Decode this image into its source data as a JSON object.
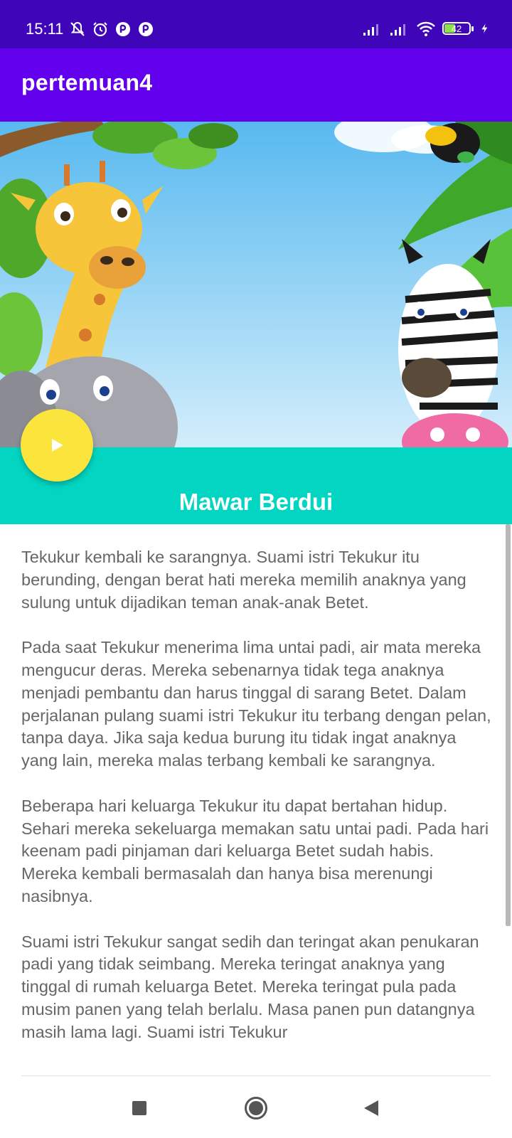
{
  "status_bar": {
    "time": "15:11",
    "icons_left": [
      "notifications-off-icon",
      "alarm-icon",
      "app-icon-1",
      "app-icon-2"
    ],
    "icons_right": [
      "signal-1-icon",
      "signal-2-icon",
      "wifi-icon",
      "battery-icon",
      "charging-icon"
    ],
    "battery_level": "42"
  },
  "app_bar": {
    "title": "pertemuan4"
  },
  "song": {
    "title": "Mawar Berdui"
  },
  "fab": {
    "icon": "play-icon"
  },
  "story": {
    "paragraphs": [
      "Tekukur kembali ke sarangnya. Suami istri Tekukur itu berunding, dengan berat hati mereka memilih anaknya yang sulung untuk dijadikan teman anak-anak Betet.",
      "Pada saat Tekukur menerima lima untai padi, air mata mereka mengucur deras. Mereka sebenarnya tidak tega anaknya menjadi pembantu dan harus tinggal di sarang Betet. Dalam perjalanan pulang suami istri Tekukur itu terbang dengan pelan, tanpa daya. Jika saja kedua burung itu tidak ingat anaknya yang lain, mereka malas terbang kembali ke sarangnya.",
      "Beberapa hari keluarga Tekukur itu dapat bertahan hidup. Sehari mereka sekeluarga memakan satu untai padi. Pada hari keenam padi pinjaman dari keluarga Betet sudah habis. Mereka kembali bermasalah dan hanya bisa merenungi nasibnya.",
      "Suami istri Tekukur sangat sedih dan teringat akan penukaran padi yang tidak seimbang. Mereka teringat anaknya yang tinggal di rumah keluarga Betet. Mereka teringat pula pada musim panen yang telah berlalu. Masa panen pun datangnya masih lama lagi. Suami istri Tekukur"
    ]
  },
  "nav_bar": {
    "buttons": [
      "recents-button",
      "home-button",
      "back-button"
    ]
  },
  "colors": {
    "status_bar": "#3f05b8",
    "app_bar": "#6200ee",
    "title_band": "#02d6c2",
    "fab": "#fbe43c",
    "body_text": "#666666"
  }
}
